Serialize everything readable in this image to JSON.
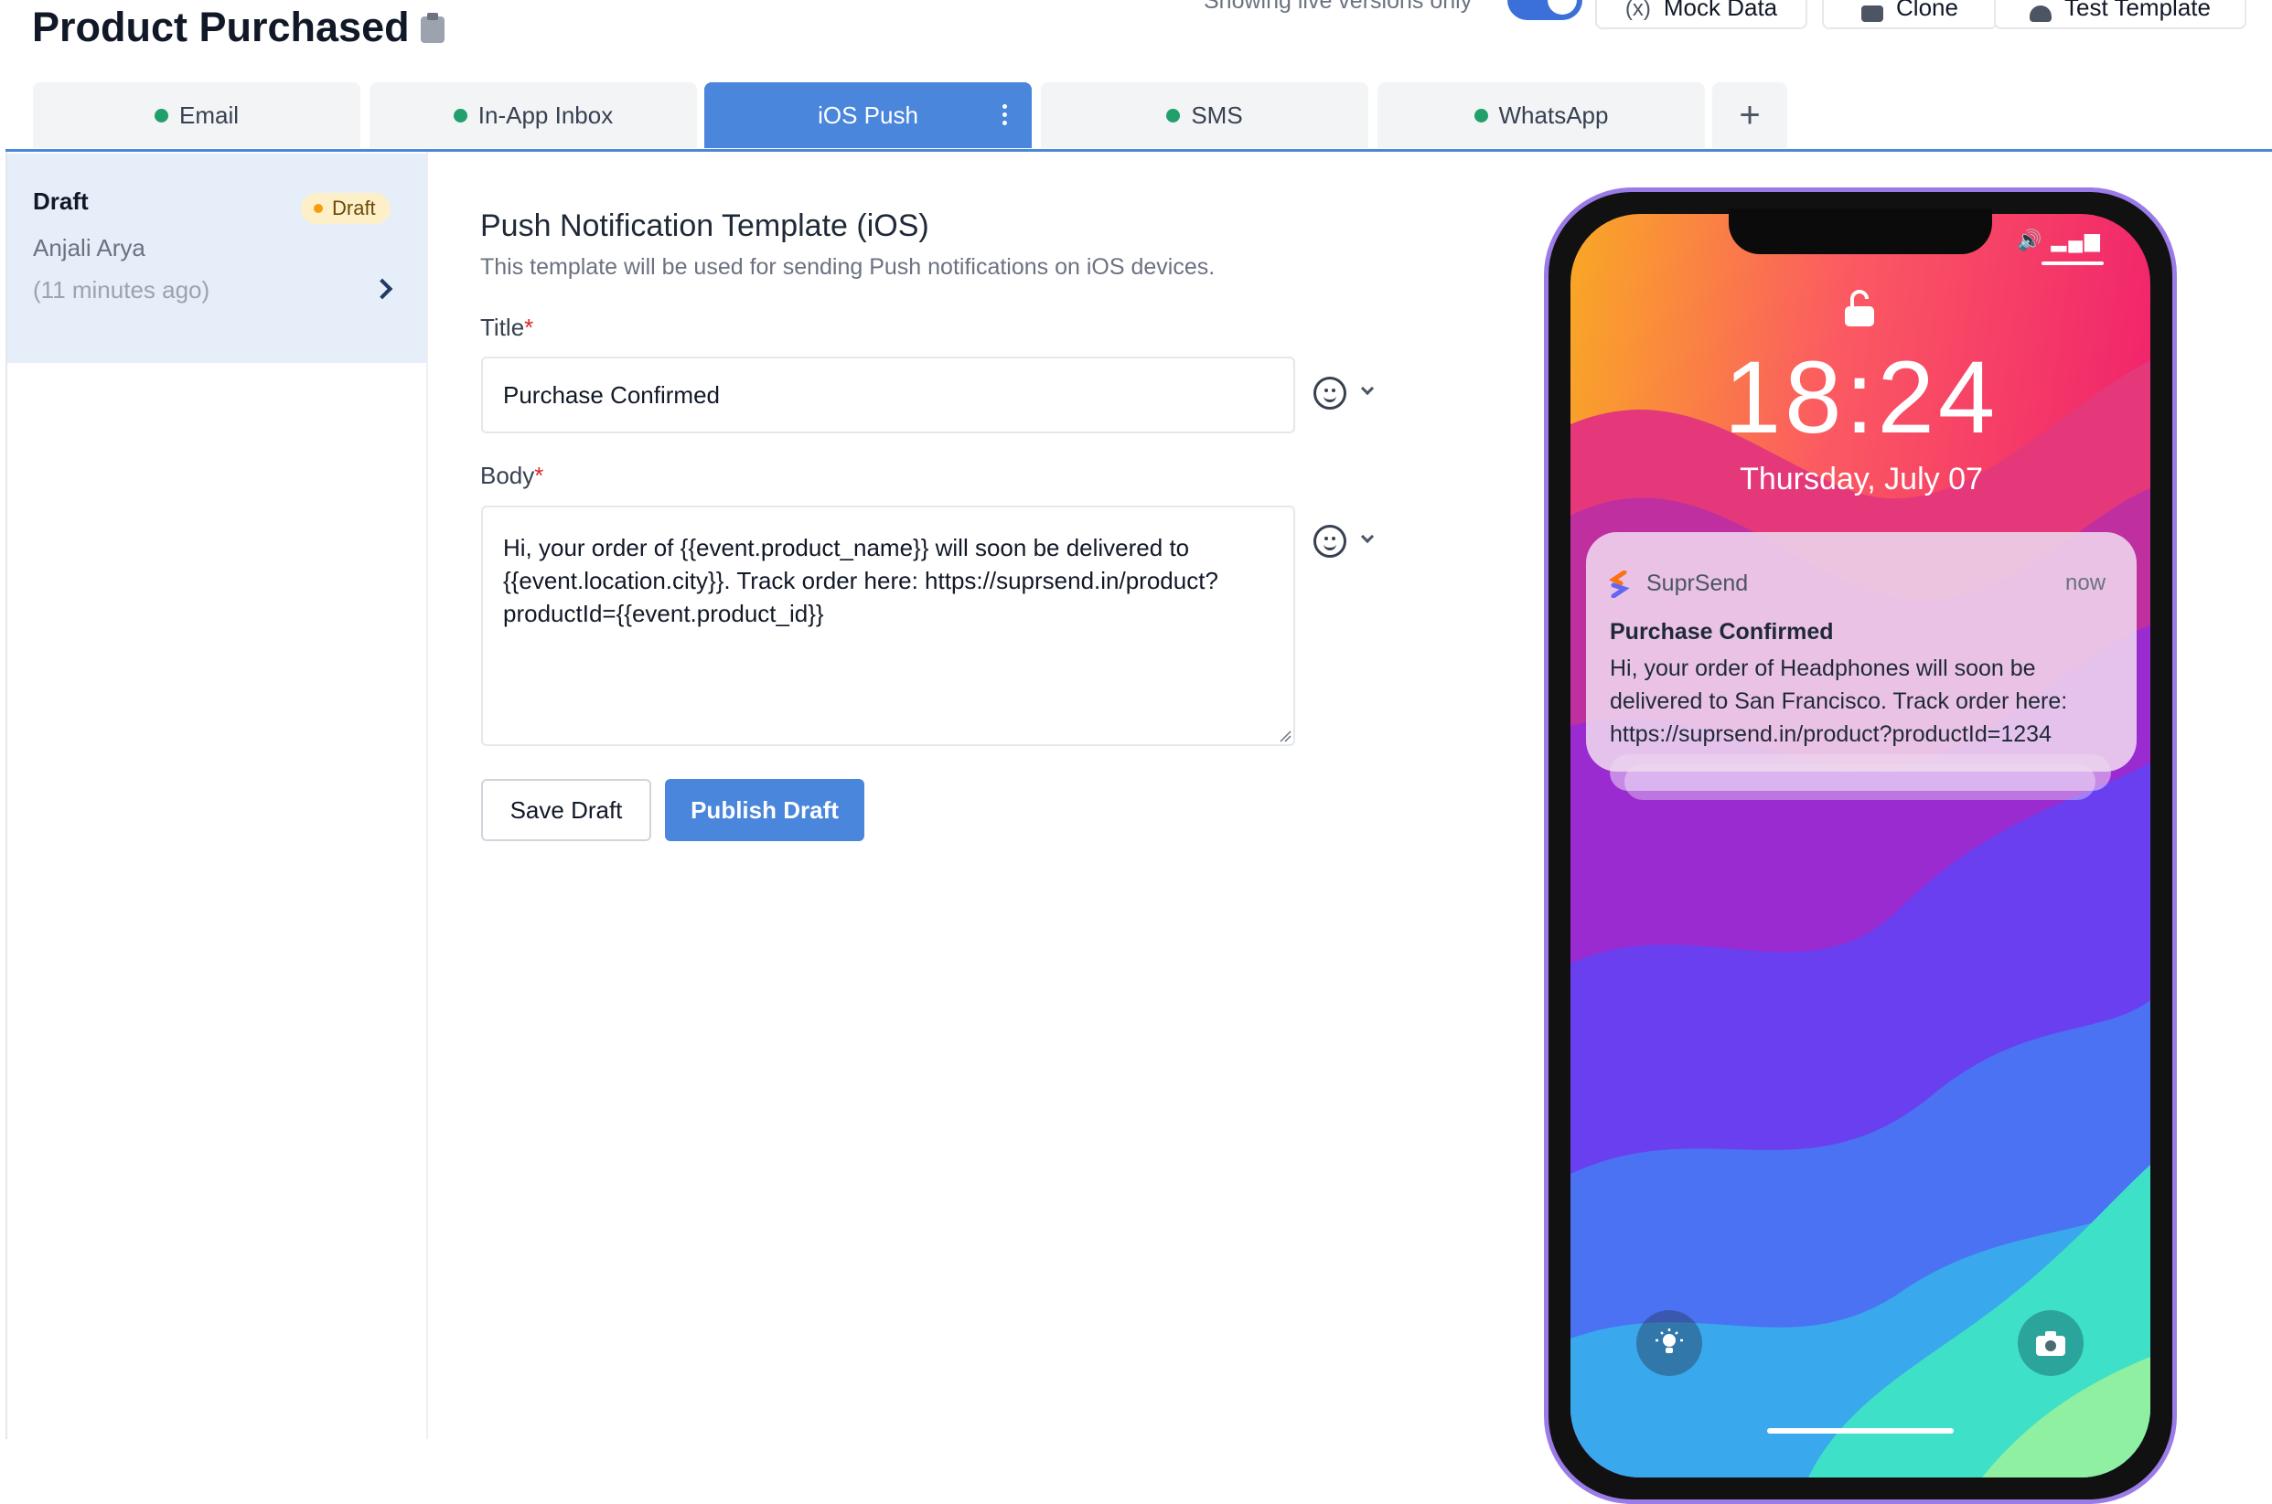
{
  "header": {
    "title": "Product Purchased",
    "live_toggle_label": "Showing live versions only",
    "live_toggle_on": true,
    "buttons": {
      "mock_data": "Mock Data",
      "clone": "Clone",
      "test_template": "Test Template"
    }
  },
  "tabs": [
    {
      "label": "Email",
      "active": false,
      "status": "green"
    },
    {
      "label": "In-App Inbox",
      "active": false,
      "status": "green"
    },
    {
      "label": "iOS Push",
      "active": true
    },
    {
      "label": "SMS",
      "active": false,
      "status": "green"
    },
    {
      "label": "WhatsApp",
      "active": false,
      "status": "green"
    }
  ],
  "add_tab_label": "+",
  "version": {
    "title": "Draft",
    "badge": "Draft",
    "author": "Anjali Arya",
    "time": "(11 minutes ago)"
  },
  "form": {
    "heading": "Push Notification Template (iOS)",
    "subheading": "This template will be used for sending Push notifications on iOS devices.",
    "title_label": "Title",
    "title_value": "Purchase Confirmed",
    "body_label": "Body",
    "body_value": "Hi, your order of {{event.product_name}} will soon be delivered to\n{{event.location.city}}. Track order here: https://suprsend.in/product?\nproductId={{event.product_id}}",
    "required_mark": "*",
    "save_label": "Save Draft",
    "publish_label": "Publish Draft"
  },
  "preview": {
    "time": "18:24",
    "date": "Thursday, July 07",
    "notification": {
      "app": "SuprSend",
      "when": "now",
      "title": "Purchase Confirmed",
      "body": "Hi, your order of Headphones will soon be delivered to San Francisco. Track order here: https://suprsend.in/product?productId=1234"
    }
  },
  "colors": {
    "accent": "#4a86db",
    "status_green": "#22a06b",
    "draft_badge_bg": "#fdf0c8",
    "phone_frame": "#9b7be8"
  }
}
